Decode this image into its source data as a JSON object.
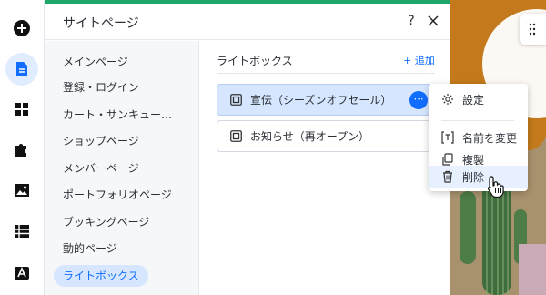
{
  "panel": {
    "title": "サイトページ",
    "help_label": "?",
    "nav_items": [
      {
        "label": "メインページ"
      },
      {
        "label": "登録・ログイン"
      },
      {
        "label": "カート・サンキュー…"
      },
      {
        "label": "ショップページ"
      },
      {
        "label": "メンバーページ"
      },
      {
        "label": "ポートフォリオページ"
      },
      {
        "label": "ブッキングページ"
      },
      {
        "label": "動的ページ"
      },
      {
        "label": "ライトボックス"
      }
    ],
    "section_title": "ライトボックス",
    "add_label": "+ 追加",
    "pages": [
      {
        "label": "宣伝（シーズンオフセール）",
        "selected": true
      },
      {
        "label": "お知らせ（再オープン）",
        "selected": false
      }
    ],
    "more_label": "⋯"
  },
  "context_menu": {
    "items": [
      {
        "label": "設定",
        "icon": "gear-icon"
      },
      {
        "label": "名前を変更",
        "icon": "rename-icon"
      },
      {
        "label": "複製",
        "icon": "duplicate-icon"
      },
      {
        "label": "削除",
        "icon": "trash-icon"
      }
    ]
  },
  "rail": {
    "icons": [
      "add-icon",
      "pages-icon",
      "apps-icon",
      "puzzle-icon",
      "media-icon",
      "table-icon",
      "store-icon"
    ]
  },
  "colors": {
    "accent": "#116dff",
    "top_bar": "#20a66b",
    "nav_active_bg": "#d6e6fe"
  }
}
